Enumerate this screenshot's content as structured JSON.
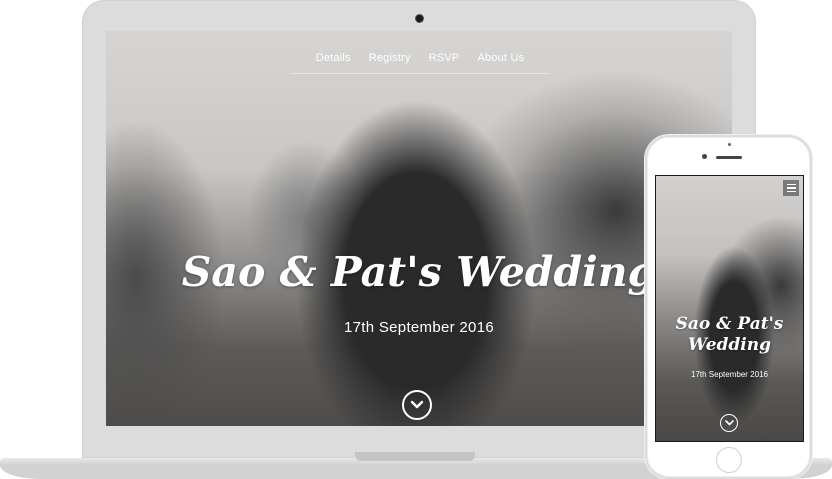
{
  "laptop": {
    "nav": {
      "items": [
        {
          "label": "Details"
        },
        {
          "label": "Registry"
        },
        {
          "label": "RSVP"
        },
        {
          "label": "About Us"
        }
      ]
    },
    "hero": {
      "title": "Sao & Pat's Wedding",
      "date": "17th September 2016",
      "scroll_icon": "chevron-down-icon"
    }
  },
  "phone": {
    "menu_icon": "hamburger-menu-icon",
    "hero": {
      "title": "Sao & Pat's Wedding",
      "date": "17th September 2016",
      "scroll_icon": "chevron-down-icon"
    }
  },
  "colors": {
    "device_frame": "#dcdcdc",
    "text": "#ffffff",
    "menu_button": "#7a7a7a"
  }
}
